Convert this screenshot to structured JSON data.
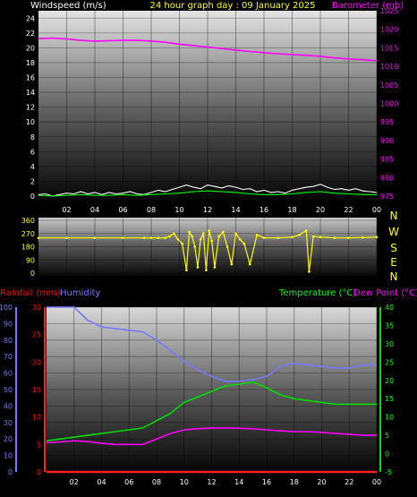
{
  "title": "24 hour graph day : 09 January 2025",
  "colors": {
    "background": "#000000",
    "wind": "#ffffff",
    "wind_gust": "#00ff00",
    "barometer": "#ff00ff",
    "wind_dir": "#ffff00",
    "rain": "#ff2020",
    "humidity": "#7878ff",
    "temperature": "#00dd00",
    "dew_point": "#ff00ff",
    "text_yellow": "#ffff00",
    "text_white": "#ffffff",
    "text_green": "#00ff00",
    "text_magenta": "#ff00ff",
    "text_red": "#ff0000",
    "text_blue": "#7878ff"
  },
  "chart_data": [
    {
      "type": "line",
      "name": "wind-barometer",
      "title": "24 hour graph day : 09 January 2025",
      "ylabel_left": "Windspeed (m/s)",
      "ylabel_right": "Barometer (mb)",
      "x_ticks": [
        "02",
        "04",
        "06",
        "08",
        "10",
        "12",
        "14",
        "16",
        "18",
        "20",
        "22",
        "00"
      ],
      "x_tick_hours": [
        2,
        4,
        6,
        8,
        10,
        12,
        14,
        16,
        18,
        20,
        22,
        24
      ],
      "xlim": [
        0,
        24
      ],
      "ylim_left": [
        0,
        25
      ],
      "left_ticks": [
        0,
        2,
        4,
        6,
        8,
        10,
        12,
        14,
        16,
        18,
        20,
        22,
        24
      ],
      "ylim_right": [
        975,
        1025
      ],
      "right_ticks": [
        975,
        980,
        985,
        990,
        995,
        1000,
        1005,
        1010,
        1015,
        1020,
        1025
      ],
      "series": [
        {
          "name": "Windspeed",
          "axis": "left",
          "x": [
            0,
            0.5,
            1,
            1.5,
            2,
            2.5,
            3,
            3.5,
            4,
            4.5,
            5,
            5.5,
            6,
            6.5,
            7,
            7.5,
            8,
            8.5,
            9,
            9.5,
            10,
            10.5,
            11,
            11.5,
            12,
            12.5,
            13,
            13.5,
            14,
            14.5,
            15,
            15.5,
            16,
            16.5,
            17,
            17.5,
            18,
            18.5,
            19,
            19.5,
            20,
            20.5,
            21,
            21.5,
            22,
            22.5,
            23,
            23.5,
            24
          ],
          "values": [
            0.2,
            0.3,
            0,
            0.2,
            0.4,
            0.3,
            0.6,
            0.3,
            0.5,
            0.2,
            0.5,
            0.3,
            0.4,
            0.6,
            0.3,
            0.2,
            0.5,
            0.8,
            0.6,
            0.9,
            1.2,
            1.5,
            1.2,
            1.0,
            1.5,
            1.3,
            1.1,
            1.4,
            1.2,
            0.9,
            1.0,
            0.6,
            0.8,
            0.5,
            0.6,
            0.4,
            0.8,
            1.0,
            1.2,
            1.3,
            1.6,
            1.2,
            0.9,
            1.0,
            0.8,
            1.0,
            0.7,
            0.6,
            0.5
          ]
        },
        {
          "name": "Wind gust",
          "axis": "left",
          "x": [
            0,
            1,
            2,
            3,
            4,
            5,
            6,
            7,
            8,
            9,
            10,
            11,
            12,
            13,
            14,
            15,
            16,
            17,
            18,
            19,
            20,
            21,
            22,
            23,
            24
          ],
          "values": [
            0.1,
            0,
            0.1,
            0.2,
            0.1,
            0.1,
            0.2,
            0.1,
            0.2,
            0.3,
            0.4,
            0.6,
            0.7,
            0.6,
            0.5,
            0.3,
            0.2,
            0.2,
            0.3,
            0.5,
            0.6,
            0.4,
            0.3,
            0.2,
            0.2
          ]
        },
        {
          "name": "Barometer",
          "axis": "right",
          "x": [
            0,
            1,
            2,
            3,
            4,
            5,
            6,
            7,
            8,
            9,
            10,
            11,
            12,
            13,
            14,
            15,
            16,
            17,
            18,
            19,
            20,
            21,
            22,
            23,
            24
          ],
          "values": [
            1017.5,
            1017.6,
            1017.4,
            1017.0,
            1016.8,
            1016.9,
            1017.0,
            1017.0,
            1016.8,
            1016.5,
            1016.0,
            1015.6,
            1015.2,
            1014.8,
            1014.4,
            1014.0,
            1013.7,
            1013.4,
            1013.2,
            1013.0,
            1012.7,
            1012.3,
            1012.0,
            1011.8,
            1011.5
          ]
        }
      ]
    },
    {
      "type": "scatter",
      "name": "wind-direction",
      "ylabel_right_letters": [
        "N",
        "W",
        "S",
        "E",
        "N"
      ],
      "x_ticks": [
        "02",
        "04",
        "06",
        "08",
        "10",
        "12",
        "14",
        "16",
        "18",
        "20",
        "22",
        "00"
      ],
      "xlim": [
        0,
        24
      ],
      "ylim": [
        0,
        360
      ],
      "left_ticks": [
        0,
        90,
        180,
        270,
        360
      ],
      "series": [
        {
          "name": "Wind direction",
          "x": [
            0,
            2,
            4,
            6,
            7.5,
            8,
            8.5,
            9,
            9.3,
            9.6,
            9.9,
            10.2,
            10.5,
            10.7,
            10.9,
            11.1,
            11.3,
            11.5,
            11.7,
            11.9,
            12.1,
            12.3,
            12.5,
            12.8,
            13.1,
            13.4,
            13.7,
            14,
            14.3,
            14.6,
            15,
            15.5,
            16,
            17,
            18,
            18.5,
            19,
            19.2,
            19.5,
            20,
            21,
            22,
            23,
            24
          ],
          "values": [
            240,
            240,
            240,
            240,
            240,
            240,
            240,
            240,
            250,
            270,
            230,
            200,
            20,
            280,
            250,
            180,
            40,
            230,
            270,
            20,
            290,
            220,
            40,
            250,
            280,
            180,
            60,
            270,
            230,
            200,
            60,
            260,
            240,
            240,
            245,
            260,
            290,
            10,
            250,
            245,
            240,
            240,
            242,
            245
          ]
        }
      ]
    },
    {
      "type": "line",
      "name": "rain-humidity-temperature",
      "ylabel_left_rain": "Rainfall (mm)",
      "ylabel_left_humidity": "Humidity",
      "ylabel_right_temp": "Temperature (°C)",
      "ylabel_right_dew": "Dew Point (°C)",
      "x_ticks": [
        "02",
        "04",
        "06",
        "08",
        "10",
        "12",
        "14",
        "16",
        "18",
        "20",
        "22",
        "00"
      ],
      "xlim": [
        0,
        24
      ],
      "humidity_ticks": [
        0,
        10,
        20,
        30,
        40,
        50,
        60,
        70,
        80,
        90,
        100
      ],
      "rain_ticks": [
        0,
        5,
        10,
        15,
        20,
        25,
        30
      ],
      "temp_ticks": [
        -5,
        0,
        5,
        10,
        15,
        20,
        25,
        30,
        35,
        40
      ],
      "ylim_humidity": [
        0,
        100
      ],
      "ylim_rain": [
        0,
        30
      ],
      "ylim_temp": [
        -5,
        40
      ],
      "series": [
        {
          "name": "Humidity",
          "axis": "humidity",
          "x": [
            0,
            1,
            2,
            3,
            4,
            5,
            6,
            7,
            8,
            9,
            10,
            11,
            12,
            13,
            14,
            15,
            16,
            17,
            18,
            19,
            20,
            21,
            22,
            23,
            24
          ],
          "values": [
            100,
            100,
            100,
            92,
            88,
            87,
            86,
            85,
            80,
            74,
            67,
            62,
            58,
            55,
            55,
            56,
            58,
            64,
            66,
            65,
            64,
            63,
            63,
            65,
            65
          ]
        },
        {
          "name": "Rainfall",
          "axis": "rain",
          "x": [
            0,
            24
          ],
          "values": [
            0,
            0
          ]
        },
        {
          "name": "Temperature",
          "axis": "temp",
          "x": [
            0,
            1,
            2,
            3,
            4,
            5,
            6,
            7,
            8,
            9,
            10,
            11,
            12,
            13,
            14,
            15,
            16,
            17,
            18,
            19,
            20,
            21,
            22,
            23,
            24
          ],
          "values": [
            3.5,
            4,
            4.5,
            5,
            5.5,
            6,
            6.5,
            7,
            9,
            11,
            14,
            15.5,
            17,
            18.5,
            19,
            19.5,
            18,
            16,
            15,
            14.5,
            14,
            13.5,
            13.5,
            13.5,
            13.5
          ]
        },
        {
          "name": "Dew Point",
          "axis": "temp",
          "x": [
            0,
            1,
            2,
            3,
            4,
            5,
            6,
            7,
            8,
            9,
            10,
            11,
            12,
            13,
            14,
            15,
            16,
            17,
            18,
            19,
            20,
            21,
            22,
            23,
            24
          ],
          "values": [
            3,
            3.2,
            3.5,
            3.3,
            2.8,
            2.5,
            2.5,
            2.5,
            4,
            5.5,
            6.5,
            6.8,
            7,
            7,
            6.9,
            6.8,
            6.5,
            6.2,
            6,
            6,
            5.8,
            5.5,
            5.3,
            5,
            5
          ]
        }
      ]
    }
  ]
}
